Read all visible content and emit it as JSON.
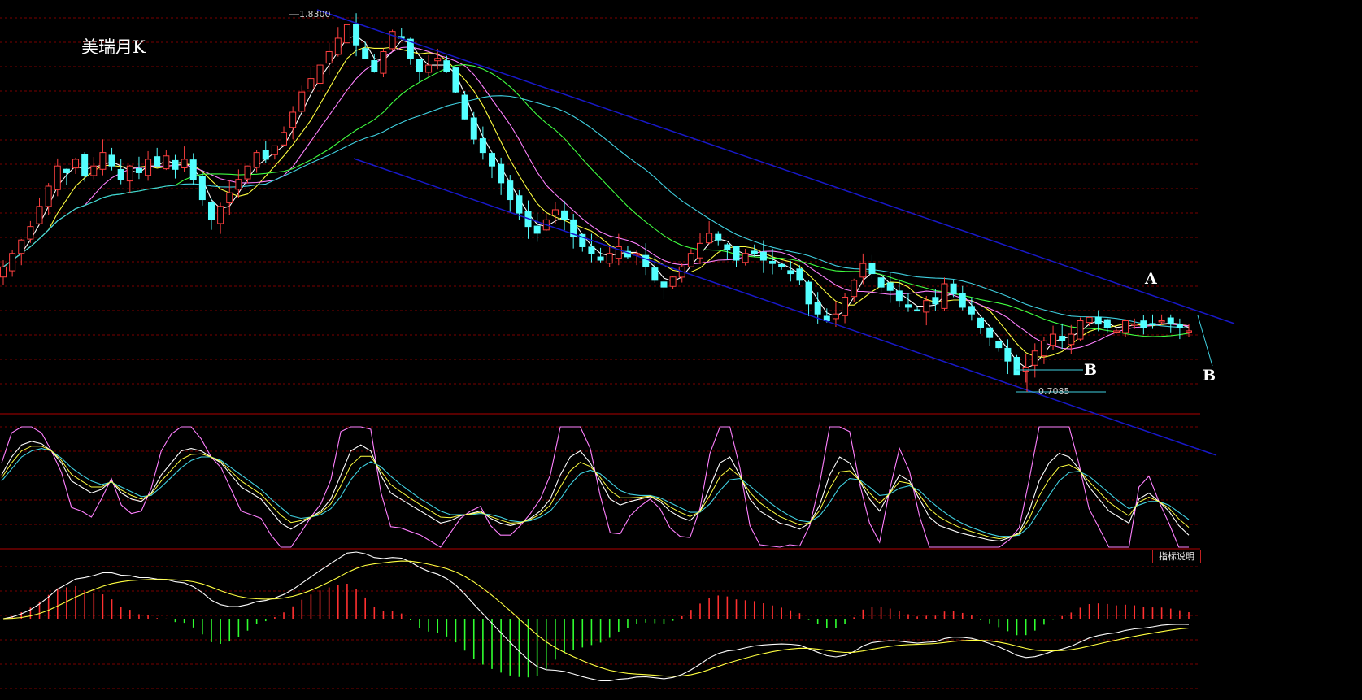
{
  "title": "美瑞月K",
  "labels": {
    "a": "A",
    "b1": "B",
    "b2": "B"
  },
  "price_high_label": "1.8300",
  "price_low_label": "0.7085",
  "indicator_button": "指标说明",
  "colors": {
    "background": "#000000",
    "up_candle": "#ff4040",
    "down_candle": "#54ffff",
    "ma_white": "#ffffff",
    "ma_yellow": "#ffff40",
    "ma_magenta": "#ff80ff",
    "ma_green": "#40ff40",
    "ma_cyan": "#40d0e0",
    "channel": "#1818c8",
    "grid": "#7a0000",
    "separator": "#b00000",
    "macd_pos": "#ff3030",
    "macd_neg": "#30ff30"
  },
  "chart_data": {
    "type": "candlestick",
    "price_high": 1.83,
    "price_low": 0.7085,
    "closes": [
      1.08,
      1.12,
      1.16,
      1.2,
      1.26,
      1.32,
      1.38,
      1.36,
      1.4,
      1.35,
      1.38,
      1.42,
      1.38,
      1.34,
      1.38,
      1.36,
      1.4,
      1.38,
      1.41,
      1.37,
      1.4,
      1.34,
      1.28,
      1.22,
      1.26,
      1.3,
      1.34,
      1.38,
      1.42,
      1.4,
      1.44,
      1.48,
      1.54,
      1.6,
      1.64,
      1.68,
      1.72,
      1.76,
      1.8,
      1.74,
      1.7,
      1.66,
      1.72,
      1.78,
      1.76,
      1.7,
      1.66,
      1.68,
      1.7,
      1.66,
      1.6,
      1.52,
      1.46,
      1.42,
      1.38,
      1.33,
      1.28,
      1.24,
      1.2,
      1.18,
      1.22,
      1.25,
      1.22,
      1.17,
      1.14,
      1.12,
      1.1,
      1.12,
      1.14,
      1.11,
      1.12,
      1.08,
      1.04,
      1.02,
      1.05,
      1.08,
      1.12,
      1.15,
      1.18,
      1.16,
      1.13,
      1.1,
      1.12,
      1.12,
      1.1,
      1.09,
      1.08,
      1.06,
      1.04,
      0.97,
      0.94,
      0.92,
      0.94,
      0.99,
      1.04,
      1.09,
      1.06,
      1.02,
      1.01,
      0.98,
      0.96,
      0.95,
      0.98,
      0.97,
      1.03,
      1.0,
      0.96,
      0.94,
      0.9,
      0.87,
      0.84,
      0.8,
      0.76,
      0.78,
      0.83,
      0.86,
      0.88,
      0.86,
      0.88,
      0.92,
      0.93,
      0.91,
      0.9,
      0.89,
      0.92,
      0.91,
      0.9,
      0.91,
      0.92,
      0.91,
      0.9,
      0.89
    ],
    "kdj": {
      "k": [
        60,
        75,
        85,
        88,
        86,
        80,
        70,
        55,
        50,
        45,
        48,
        55,
        45,
        40,
        38,
        45,
        60,
        70,
        80,
        82,
        80,
        75,
        70,
        60,
        50,
        45,
        40,
        30,
        20,
        15,
        20,
        25,
        30,
        40,
        60,
        80,
        85,
        80,
        60,
        45,
        40,
        35,
        30,
        25,
        20,
        22,
        26,
        28,
        30,
        24,
        20,
        18,
        20,
        24,
        30,
        40,
        60,
        75,
        80,
        70,
        55,
        40,
        35,
        38,
        40,
        42,
        38,
        30,
        25,
        22,
        30,
        50,
        70,
        75,
        60,
        40,
        30,
        25,
        20,
        18,
        15,
        20,
        35,
        60,
        75,
        70,
        55,
        40,
        30,
        45,
        60,
        55,
        40,
        25,
        18,
        15,
        12,
        10,
        8,
        6,
        5,
        8,
        12,
        30,
        55,
        70,
        78,
        75,
        65,
        50,
        40,
        30,
        25,
        20,
        40,
        45,
        38,
        30,
        18,
        10
      ],
      "d": [
        55,
        65,
        75,
        80,
        82,
        80,
        74,
        66,
        60,
        55,
        52,
        54,
        50,
        46,
        42,
        43,
        50,
        58,
        66,
        72,
        75,
        75,
        72,
        66,
        60,
        54,
        48,
        40,
        33,
        26,
        24,
        25,
        27,
        32,
        42,
        56,
        66,
        71,
        67,
        59,
        52,
        46,
        40,
        35,
        30,
        27,
        27,
        27,
        28,
        27,
        25,
        22,
        21,
        22,
        25,
        30,
        40,
        52,
        61,
        64,
        61,
        54,
        47,
        44,
        43,
        43,
        41,
        37,
        33,
        29,
        29,
        36,
        47,
        56,
        57,
        51,
        44,
        37,
        31,
        26,
        22,
        21,
        26,
        37,
        50,
        57,
        56,
        50,
        43,
        44,
        49,
        51,
        47,
        39,
        32,
        26,
        21,
        17,
        14,
        11,
        9,
        9,
        10,
        17,
        30,
        43,
        55,
        62,
        63,
        59,
        52,
        45,
        38,
        32,
        35,
        38,
        38,
        35,
        29,
        23
      ],
      "j": [
        70,
        95,
        100,
        100,
        95,
        80,
        62,
        33,
        30,
        25,
        40,
        57,
        35,
        28,
        30,
        49,
        80,
        94,
        100,
        100,
        90,
        75,
        66,
        48,
        30,
        27,
        24,
        10,
        0,
        0,
        12,
        25,
        36,
        56,
        96,
        100,
        100,
        98,
        46,
        17,
        16,
        13,
        10,
        5,
        0,
        12,
        24,
        30,
        34,
        18,
        10,
        10,
        18,
        28,
        40,
        60,
        100,
        100,
        100,
        82,
        43,
        12,
        11,
        26,
        34,
        40,
        32,
        16,
        9,
        8,
        32,
        78,
        100,
        100,
        66,
        18,
        2,
        1,
        0,
        2,
        1,
        18,
        53,
        100,
        100,
        96,
        53,
        20,
        4,
        47,
        82,
        63,
        26,
        0,
        0,
        0,
        0,
        0,
        0,
        0,
        0,
        6,
        16,
        56,
        100,
        100,
        100,
        100,
        69,
        32,
        16,
        0,
        0,
        0,
        50,
        59,
        38,
        20,
        0,
        0
      ]
    },
    "annotations": [
      "A",
      "B",
      "B"
    ]
  }
}
